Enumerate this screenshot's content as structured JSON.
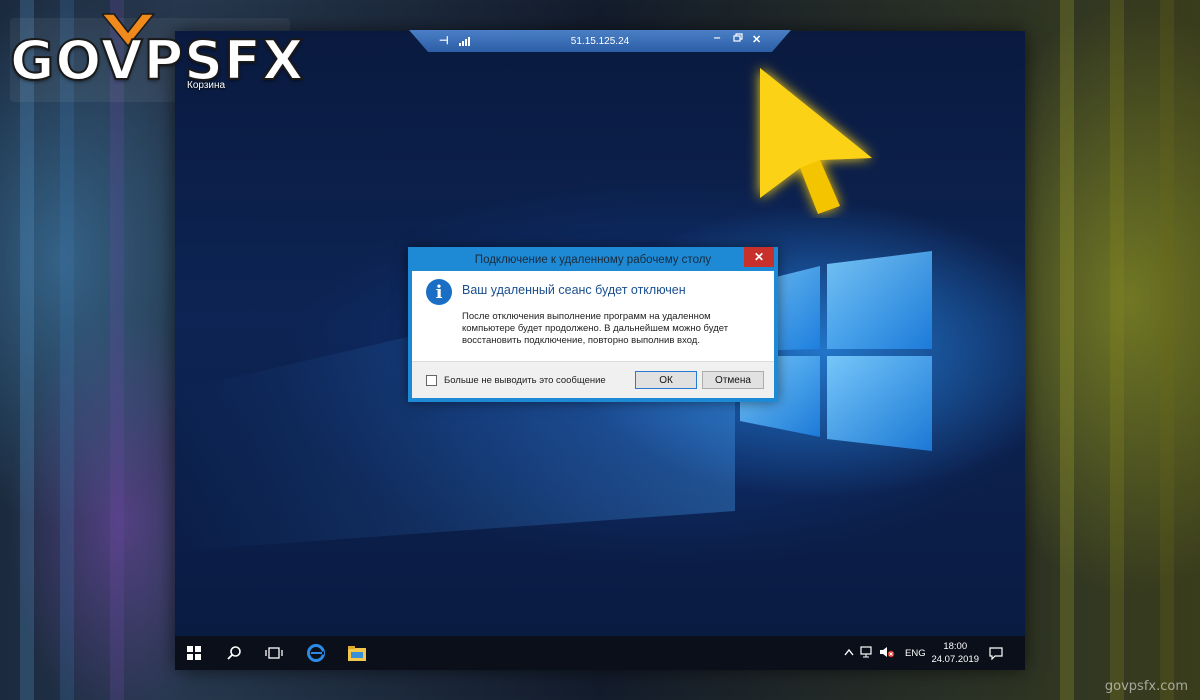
{
  "brand": {
    "logo_text": "GOVPSFX",
    "watermark": "govpsfx.com"
  },
  "desktop": {
    "icon_label": "Корзина"
  },
  "connection_bar": {
    "ip": "51.15.125.24",
    "pin_icon": "pin-icon",
    "signal_icon": "signal-icon",
    "minimize_icon": "minimize-icon",
    "restore_icon": "restore-icon",
    "close_icon": "close-icon",
    "color": "#2c5ea6"
  },
  "dialog": {
    "title": "Подключение к удаленному рабочему столу",
    "close_label": "✕",
    "heading": "Ваш удаленный сеанс будет отключен",
    "message": "После отключения выполнение программ на удаленном компьютере будет продолжено. В дальнейшем можно будет восстановить подключение, повторно выполнив вход.",
    "checkbox_label": "Больше не выводить это сообщение",
    "ok_label": "ОК",
    "cancel_label": "Отмена",
    "accent_color": "#1e8ad6"
  },
  "taskbar": {
    "items": [
      "windows-start-icon",
      "search-icon",
      "task-view-icon",
      "edge-icon",
      "file-explorer-icon"
    ],
    "tray_icons": [
      "chevron-up-icon",
      "network-icon",
      "volume-icon"
    ],
    "language": "ENG",
    "time": "18:00",
    "date": "24.07.2019",
    "notification_icon": "notification-icon"
  },
  "annotation": {
    "pointer_icon": "yellow-arrow-pointer-icon",
    "color": "#f5c400"
  }
}
